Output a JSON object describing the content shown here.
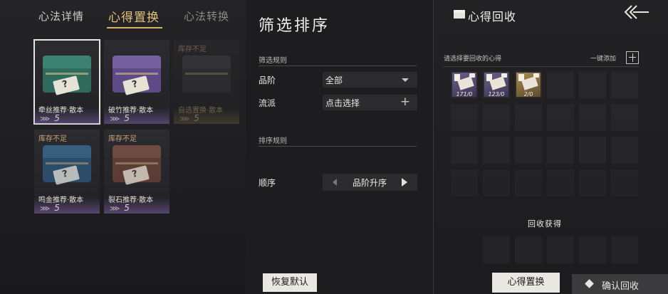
{
  "tabs": {
    "details": "心法详情",
    "replace": "心得置换",
    "convert": "心法转换"
  },
  "cards": [
    {
      "status": "",
      "name": "牵丝推荐·散本",
      "count": "5",
      "colors": [
        "#2f6b5c",
        "#225046"
      ]
    },
    {
      "status": "",
      "name": "破竹推荐·散本",
      "count": "5",
      "colors": [
        "#5e4a86",
        "#44366a"
      ]
    },
    {
      "status": "库存不足",
      "name": "自选置换·散本",
      "count": "5",
      "colors": [
        "#5a4a30",
        "#3d3222"
      ]
    },
    {
      "status": "库存不足",
      "name": "鸣金推荐·散本",
      "count": "5",
      "colors": [
        "#2e5a7e",
        "#23465f"
      ]
    },
    {
      "status": "库存不足",
      "name": "裂石推荐·散本",
      "count": "5",
      "colors": [
        "#6e4338",
        "#4e3029"
      ]
    }
  ],
  "filter": {
    "title": "筛选排序",
    "rules_label": "筛选规则",
    "grade_label": "品阶",
    "grade_value": "全部",
    "school_label": "流派",
    "school_value": "点击选择",
    "sort_label": "排序规则",
    "order_label": "顺序",
    "order_value": "品阶升序",
    "reset_button": "恢复默认"
  },
  "recycle": {
    "title": "心得回收",
    "hint": "请选择要回收的心得",
    "add_all": "一键添加",
    "items": [
      {
        "count": "171/0",
        "style": "purple"
      },
      {
        "count": "123/0",
        "style": "purple"
      },
      {
        "count": "2/0",
        "style": "gold"
      }
    ],
    "gain_label": "回收获得",
    "replace_button": "心得置换",
    "confirm_button": "确认回收"
  },
  "colors": {
    "accent": "#d9b46a",
    "panel": "#1d1d1f"
  }
}
